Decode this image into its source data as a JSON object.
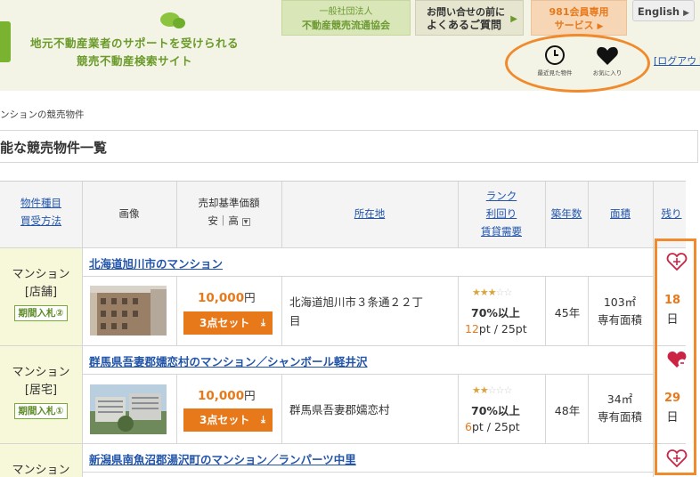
{
  "header": {
    "tagline_line1": "地元不動産業者のサポートを受けられる",
    "tagline_line2": "競売不動産検索サイト",
    "association_line1": "一般社団法人",
    "association_line2": "不動産競売流通協会",
    "faq_line1": "お問い合せの前に",
    "faq_line2": "よくあるご質問",
    "member_line1": "981会員専用",
    "member_line2": "サービス",
    "english": "English",
    "recently_viewed": "最近見た物件",
    "favorites": "お気に入り",
    "logout": "[ログアウト]",
    "icons": {
      "recently_viewed": "clock-icon",
      "favorites": "heart-icon"
    }
  },
  "breadcrumb": "ンションの競売物件",
  "page_title": "能な競売物件一覧",
  "columns": {
    "type_line1": "物件種目",
    "type_line2": "買受方法",
    "image": "画像",
    "price_line1": "売却基準価額",
    "price_sort": "安｜高",
    "address": "所在地",
    "rank_line1": "ランク",
    "rank_line2": "利回り",
    "rank_line3": "賃貸需要",
    "age": "築年数",
    "area": "面積",
    "remaining": "残り"
  },
  "listings": [
    {
      "type": "マンション",
      "subtype": "[店舗]",
      "bid_method": "期間入札②",
      "title": "北海道旭川市のマンション",
      "price": "10,000",
      "price_unit": "円",
      "set_button": "3点セット",
      "address_line1": "北海道旭川市３条通２２丁",
      "address_line2": "目",
      "stars_filled": 3,
      "stars_total": 5,
      "yield": "70%以上",
      "points": "12",
      "points_suffix": "pt / 25pt",
      "age": "45年",
      "area": "103㎡",
      "area_type": "専有面積",
      "days": "18",
      "days_unit": "日",
      "favorited": false
    },
    {
      "type": "マンション",
      "subtype": "[居宅]",
      "bid_method": "期間入札①",
      "title": "群馬県吾妻郡嬬恋村のマンション／シャンボール軽井沢",
      "price": "10,000",
      "price_unit": "円",
      "set_button": "3点セット",
      "address_line1": "群馬県吾妻郡嬬恋村",
      "address_line2": "",
      "stars_filled": 2,
      "stars_total": 5,
      "yield": "70%以上",
      "points": "6",
      "points_suffix": "pt / 25pt",
      "age": "48年",
      "area": "34㎡",
      "area_type": "専有面積",
      "days": "29",
      "days_unit": "日",
      "favorited": true
    },
    {
      "type": "マンション",
      "title": "新潟県南魚沼郡湯沢町のマンション／ランパーツ中里",
      "favorited": false
    }
  ],
  "colors": {
    "accent_orange": "#e8791b",
    "brand_green": "#6a9a2a",
    "link_blue": "#2255aa",
    "annotation_orange": "#f08a2c",
    "heart_red": "#cc2244"
  }
}
